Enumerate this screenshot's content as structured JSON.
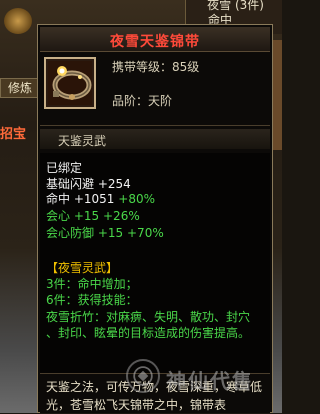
{
  "background": {
    "top_right_line1": "夜雪 (3件)",
    "top_right_line2": "命中",
    "left_button": "修炼",
    "left_text": "招宝"
  },
  "tooltip": {
    "title": "夜雪天鉴锦带",
    "title_color": "#ff4a3a",
    "required_level": "携带等级：85级",
    "rank": "品阶：天阶",
    "category": "天鉴灵武",
    "bound": "已绑定",
    "stats": [
      {
        "name": "基础闪避",
        "value": "+254",
        "bonus": ""
      },
      {
        "name": "命中",
        "value": "+1051",
        "bonus": "+80%"
      },
      {
        "name": "会心",
        "value": "+15",
        "bonus": "+26%"
      },
      {
        "name": "会心防御",
        "value": "+15",
        "bonus": "+70%"
      }
    ],
    "set_name": "【夜雪灵武】",
    "set_bonus_3": "3件：命中增加；",
    "set_bonus_6": "6件：获得技能：",
    "skill_line1": "夜雪折竹：对麻痹、失明、散功、封穴",
    "skill_line2": "、封印、眩晕的目标造成的伤害提高。",
    "lore": "天鉴之法，可传万物，夜雪深重，寒草低光，苍雪松飞天锦带之中，锦带表"
  },
  "watermark": {
    "text": "神仙代售",
    "logo_icon": "circle-emblem-icon"
  },
  "icon": {
    "item_icon": "belt-icon"
  }
}
